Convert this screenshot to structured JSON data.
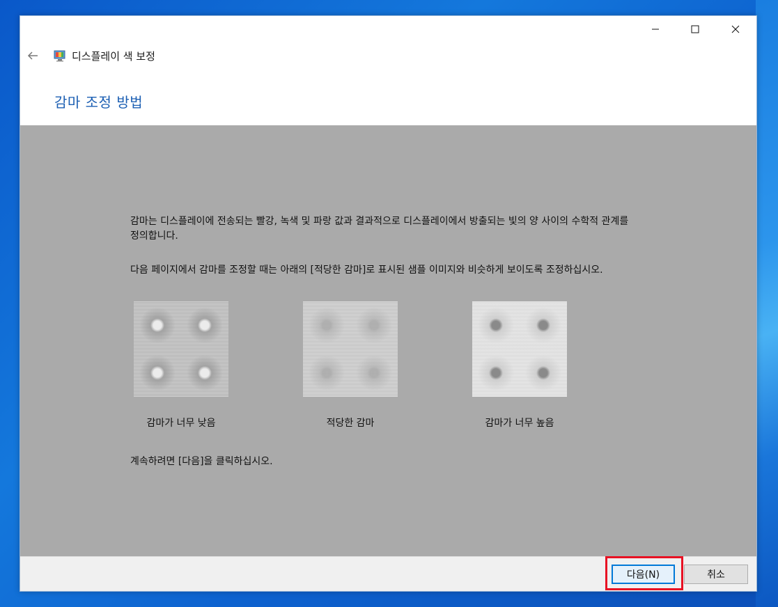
{
  "window": {
    "app_title": "디스플레이 색 보정",
    "controls": {
      "minimize": "minimize-icon",
      "maximize": "maximize-icon",
      "close": "close-icon"
    }
  },
  "page": {
    "title": "감마 조정 방법",
    "para1": "감마는 디스플레이에 전송되는 빨강, 녹색 및 파랑 값과 결과적으로 디스플레이에서 방출되는 빛의 양 사이의 수학적 관계를 정의합니다.",
    "para2": "다음 페이지에서 감마를 조정할 때는 아래의 [적당한 감마]로 표시된 샘플 이미지와 비슷하게 보이도록 조정하십시오.",
    "samples": [
      {
        "caption": "감마가 너무 낮음"
      },
      {
        "caption": "적당한 감마"
      },
      {
        "caption": "감마가 너무 높음"
      }
    ],
    "continue_text": "계속하려면 [다음]을 클릭하십시오."
  },
  "footer": {
    "next_label": "다음(N)",
    "cancel_label": "취소"
  },
  "colors": {
    "title_blue": "#1c5fb3",
    "content_gray": "#aaaaaa",
    "focus_blue": "#0078d7",
    "highlight_red": "#e81123"
  }
}
